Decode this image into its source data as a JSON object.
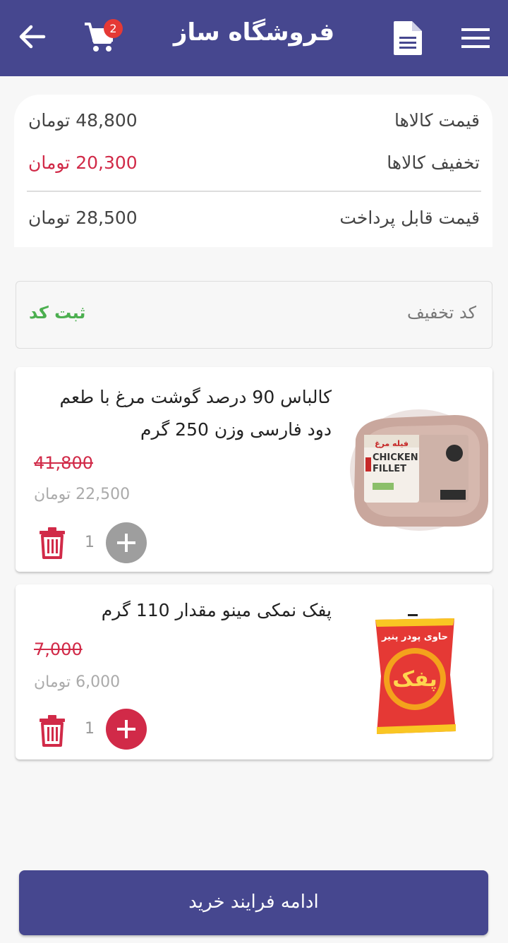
{
  "header": {
    "title": "فروشگاه ساز",
    "cart_count": "2"
  },
  "summary": {
    "items_price_label": "قیمت کالاها",
    "items_price_value": "48,800 تومان",
    "discount_label": "تخفیف کالاها",
    "discount_value": "20,300 تومان",
    "payable_label": "قیمت قابل پرداخت",
    "payable_value": "28,500 تومان"
  },
  "coupon": {
    "placeholder": "کد تخفیف",
    "apply_label": "ثبت کد"
  },
  "products": [
    {
      "name": "کالباس 90 درصد گوشت مرغ با طعم دود فارسی وزن 250 گرم",
      "old_price": "41,800",
      "price": "22,500 تومان",
      "quantity": "1",
      "plus_color": "#9e9e9e",
      "image_text": "CHICKEN FILLET",
      "image_subtext": "فیله مرغ"
    },
    {
      "name": "پفک نمکی مینو مقدار 110 گرم",
      "old_price": "7,000",
      "price": "6,000 تومان",
      "quantity": "1",
      "plus_color": "#d12a48",
      "image_text": "پفک",
      "image_subtext": "حاوی پودر پنیر"
    }
  ],
  "checkout": {
    "label": "ادامه فرایند خرید"
  },
  "colors": {
    "appbar": "#46478f",
    "accent_red": "#d12a48",
    "apply_green": "#4caf50"
  },
  "icons": [
    "back-arrow-icon",
    "cart-icon",
    "document-icon",
    "menu-icon",
    "trash-icon",
    "plus-icon"
  ]
}
